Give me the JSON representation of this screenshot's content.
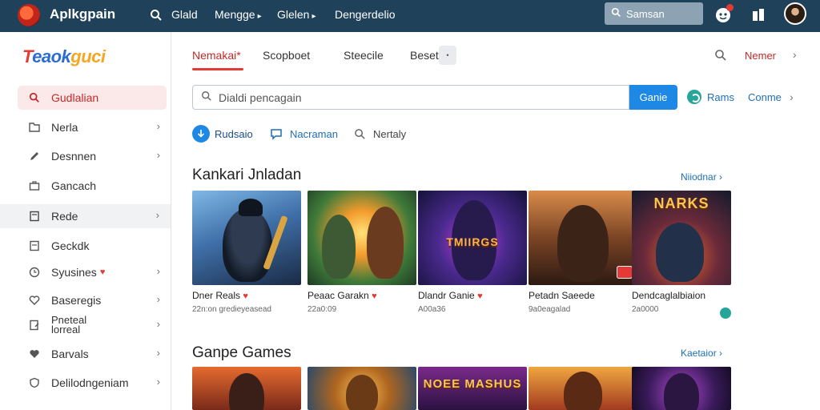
{
  "topbar": {
    "app_title": "Aplkgpain",
    "nav": [
      {
        "label": "Glald",
        "arrow": ""
      },
      {
        "label": "Mengge",
        "arrow": "▸"
      },
      {
        "label": "Glelen",
        "arrow": "▸"
      },
      {
        "label": "Dengerdelio",
        "arrow": ""
      }
    ],
    "search_label": "Samsan"
  },
  "sidebar": {
    "brand": {
      "a": "T",
      "b": "eaok",
      "c": "guci"
    },
    "items": [
      {
        "label": "Gudlalian"
      },
      {
        "label": "Nerla"
      },
      {
        "label": "Desnnen"
      },
      {
        "label": "Gancach"
      },
      {
        "label": "Rede"
      },
      {
        "label": "Geckdk"
      },
      {
        "label": "Syusines"
      },
      {
        "label": "Baseregis"
      },
      {
        "label_line1": "Pneteal",
        "label_line2": "lorreal"
      },
      {
        "label": "Barvals"
      },
      {
        "label": "Delilodngeniam"
      }
    ]
  },
  "tabs": [
    {
      "label": "Nemakai*"
    },
    {
      "label": "Scopboet"
    },
    {
      "label": "Steecile"
    },
    {
      "label": "Beset"
    }
  ],
  "tab_chip": "•",
  "top_right_link": "Nemer",
  "search": {
    "placeholder": "Dialdi pencagain",
    "button": "Ganie",
    "rams": "Rams",
    "conme": "Conme"
  },
  "filters": [
    {
      "label": "Rudsaio"
    },
    {
      "label": "Nacraman"
    },
    {
      "label": "Nertaly"
    }
  ],
  "sections": [
    {
      "title": "Kankari Jnladan",
      "link": "Niiodnar ›",
      "cards": [
        {
          "name": "Dner Reals",
          "heart": "♥",
          "sub": "22n:on gredieyeasead"
        },
        {
          "name": "Peaac Garakn",
          "heart": "♥",
          "sub": "22a0:09"
        },
        {
          "name": "Dlandr Ganie",
          "heart": "♥",
          "sub": "A00a36"
        },
        {
          "name": "Petadn Saeede",
          "heart": "",
          "sub": "9a0eagalad"
        },
        {
          "name": "Dendcaglalbiaion",
          "heart": "",
          "sub": "2a0000"
        }
      ]
    },
    {
      "title": "Ganpe Games",
      "link": "Kaetaior ›",
      "cards": [
        {},
        {},
        {},
        {},
        {}
      ]
    }
  ],
  "thumb_texts": {
    "card3": "TMIIRGS",
    "card5": "NARKS",
    "row2_card3": "NOEE MASHUS"
  }
}
